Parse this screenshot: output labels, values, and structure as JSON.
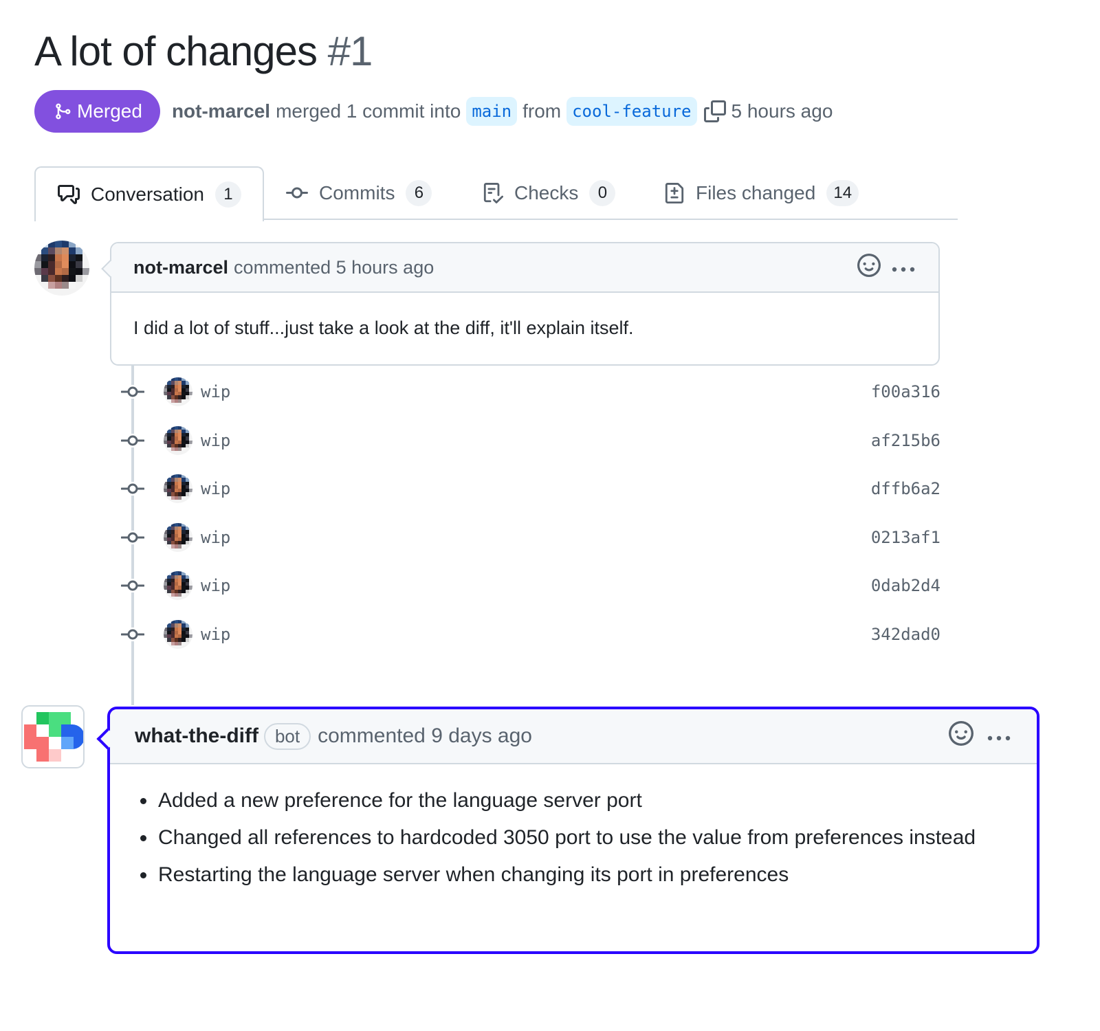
{
  "pr": {
    "title": "A lot of changes",
    "number": "#1",
    "state": "Merged",
    "author": "not-marcel",
    "merge_text": "merged 1 commit into",
    "base_branch": "main",
    "from_text": "from",
    "head_branch": "cool-feature",
    "time": "5 hours ago",
    "colors": {
      "merged": "#8250df",
      "branch_bg": "#ddf4ff",
      "branch_fg": "#0969da",
      "highlight": "#2a00ff"
    }
  },
  "tabs": [
    {
      "label": "Conversation",
      "count": "1",
      "icon": "comment-discussion-icon",
      "active": true
    },
    {
      "label": "Commits",
      "count": "6",
      "icon": "git-commit-icon",
      "active": false
    },
    {
      "label": "Checks",
      "count": "0",
      "icon": "checklist-icon",
      "active": false
    },
    {
      "label": "Files changed",
      "count": "14",
      "icon": "file-diff-icon",
      "active": false
    }
  ],
  "comment": {
    "author": "not-marcel",
    "action": "commented 5 hours ago",
    "body": "I did a lot of stuff...just take a look at the diff, it'll explain itself."
  },
  "commits": [
    {
      "message": "wip",
      "sha": "f00a316"
    },
    {
      "message": "wip",
      "sha": "af215b6"
    },
    {
      "message": "wip",
      "sha": "dffb6a2"
    },
    {
      "message": "wip",
      "sha": "0213af1"
    },
    {
      "message": "wip",
      "sha": "0dab2d4"
    },
    {
      "message": "wip",
      "sha": "342dad0"
    }
  ],
  "bot_comment": {
    "author": "what-the-diff",
    "badge": "bot",
    "action": "commented 9 days ago",
    "items": [
      "Added a new preference for the language server port",
      "Changed all references to hardcoded 3050 port to use the value from preferences instead",
      "Restarting the language server when changing its port in preferences"
    ]
  }
}
